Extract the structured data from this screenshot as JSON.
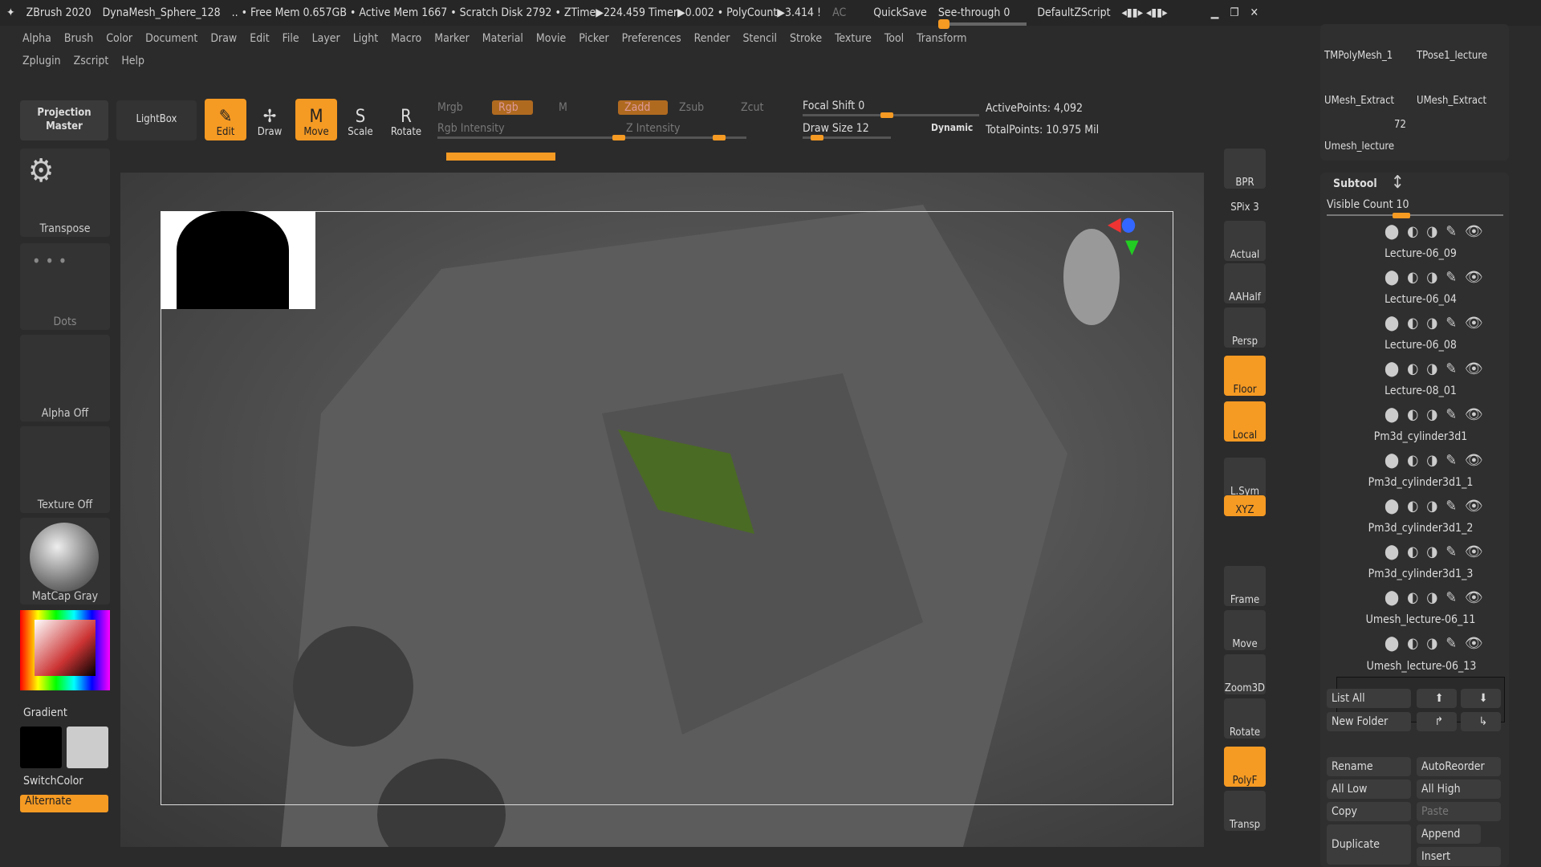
{
  "titlebar": {
    "app": "ZBrush 2020",
    "doc": "DynaMesh_Sphere_128",
    "stats": ".. • Free Mem 0.657GB • Active Mem 1667 • Scratch Disk 2792 • ZTime▶224.459 Timer▶0.002 • PolyCount▶3.414 !",
    "ac": "AC",
    "quicksave": "QuickSave",
    "seethrough": "See-through  0",
    "script": "DefaultZScript"
  },
  "menu1": [
    "Alpha",
    "Brush",
    "Color",
    "Document",
    "Draw",
    "Edit",
    "File",
    "Layer",
    "Light",
    "Macro",
    "Marker",
    "Material",
    "Movie",
    "Picker",
    "Preferences",
    "Render",
    "Stencil",
    "Stroke",
    "Texture",
    "Tool",
    "Transform"
  ],
  "menu2": [
    "Zplugin",
    "Zscript",
    "Help"
  ],
  "toolbar": {
    "projection_master": "Projection Master",
    "lightbox": "LightBox",
    "edit": "Edit",
    "draw": "Draw",
    "move": "Move",
    "scale": "Scale",
    "rotate": "Rotate",
    "mrgb": "Mrgb",
    "rgb": "Rgb",
    "m": "M",
    "zadd": "Zadd",
    "zsub": "Zsub",
    "zcut": "Zcut",
    "rgb_intensity": "Rgb Intensity",
    "z_intensity": "Z Intensity",
    "focal_shift": "Focal Shift 0",
    "draw_size": "Draw Size 12",
    "dynamic": "Dynamic",
    "active_points": "ActivePoints: 4,092",
    "total_points": "TotalPoints: 10.975 Mil"
  },
  "leftshelf": {
    "transpose": "Transpose",
    "dots": "Dots",
    "alpha": "Alpha Off",
    "texture": "Texture Off",
    "matcap": "MatCap Gray",
    "gradient": "Gradient",
    "switchcolor": "SwitchColor",
    "alternate": "Alternate"
  },
  "rightshelf": [
    "BPR",
    "SPix 3",
    "Actual",
    "AAHalf",
    "Persp",
    "Floor",
    "Local",
    "L.Sym",
    "XYZ",
    "Frame",
    "Move",
    "Zoom3D",
    "Rotate",
    "PolyF",
    "Transp"
  ],
  "tools": {
    "t1": "TMPolyMesh_1",
    "t2": "TPose1_lecture",
    "t3": "UMesh_Extract",
    "t4": "UMesh_Extract",
    "t5": "Umesh_lecture",
    "count": "72"
  },
  "subtool": {
    "title": "Subtool",
    "visible_count": "Visible Count 10",
    "items": [
      "Lecture-06_09",
      "Lecture-06_04",
      "Lecture-06_08",
      "Lecture-08_01",
      "Pm3d_cylinder3d1",
      "Pm3d_cylinder3d1_1",
      "Pm3d_cylinder3d1_2",
      "Pm3d_cylinder3d1_3",
      "Umesh_lecture-06_11",
      "Umesh_lecture-06_13"
    ],
    "buttons": {
      "list_all": "List All",
      "new_folder": "New Folder",
      "rename": "Rename",
      "autoreorder": "AutoReorder",
      "all_low": "All Low",
      "all_high": "All High",
      "copy": "Copy",
      "paste": "Paste",
      "duplicate": "Duplicate",
      "append": "Append",
      "insert": "Insert"
    }
  },
  "colors": {
    "accent": "#f59a23",
    "bg": "#2b2b2b"
  }
}
